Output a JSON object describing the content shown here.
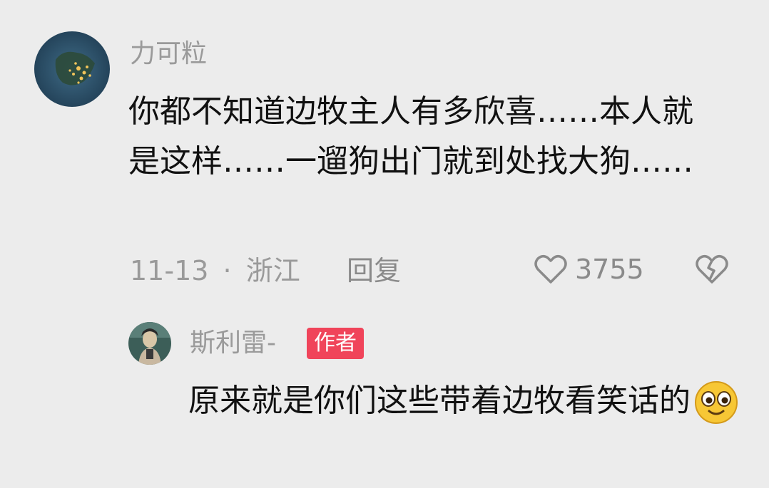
{
  "comment": {
    "username": "力可粒",
    "text": "你都不知道边牧主人有多欣喜……本人就是这样……一遛狗出门就到处找大狗……",
    "date": "11-13",
    "separator": "·",
    "location": "浙江",
    "reply_label": "回复",
    "like_count": "3755",
    "avatar_icon": "earth-night-map-avatar",
    "like_icon": "heart-outline-icon",
    "dislike_icon": "broken-heart-icon"
  },
  "reply": {
    "username": "斯利雷-",
    "badge": "作者",
    "text": "原来就是你们这些带着边牧看笑话的",
    "emoji_icon": "smiling-face-emoji",
    "avatar_icon": "person-portrait-avatar"
  },
  "colors": {
    "background": "#ececec",
    "badge": "#f0445a",
    "text": "#111111",
    "muted": "#9a9a9a"
  }
}
